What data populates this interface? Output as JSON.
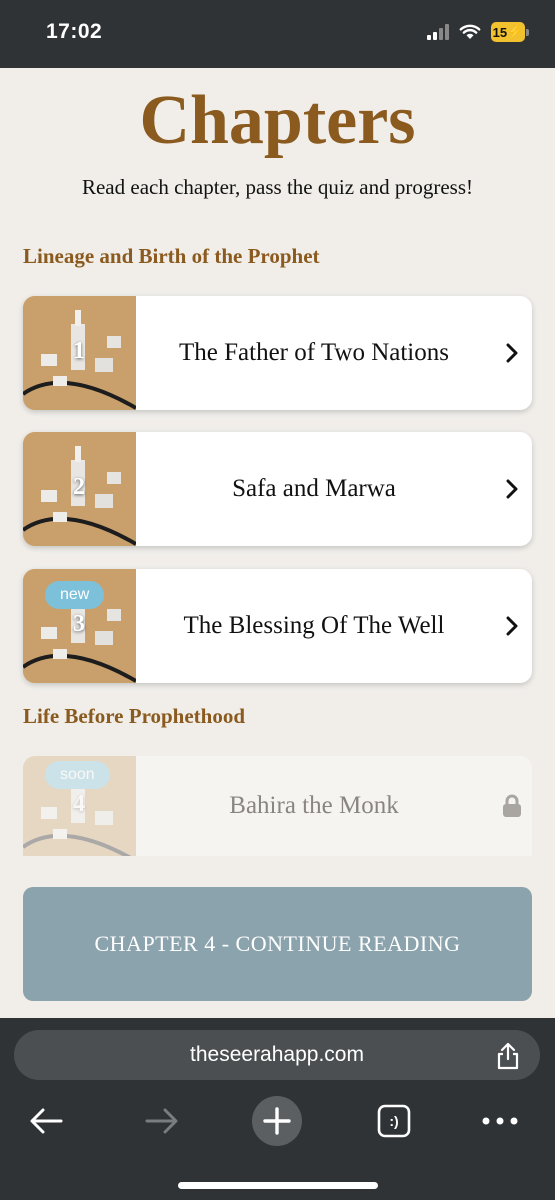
{
  "status_bar": {
    "time": "17:02",
    "battery": "15"
  },
  "page": {
    "title": "Chapters",
    "subtitle": "Read each chapter, pass the quiz and progress!"
  },
  "sections": [
    {
      "heading": "Lineage and Birth of the Prophet"
    },
    {
      "heading": "Life Before Prophethood"
    }
  ],
  "chapters": [
    {
      "number": "1",
      "title": "The Father of Two Nations",
      "badge": "",
      "locked": false
    },
    {
      "number": "2",
      "title": "Safa and Marwa",
      "badge": "",
      "locked": false
    },
    {
      "number": "3",
      "title": "The Blessing Of The Well",
      "badge": "new",
      "locked": false
    },
    {
      "number": "4",
      "title": "Bahira the Monk",
      "badge": "soon",
      "locked": true
    }
  ],
  "continue_button": {
    "label": "CHAPTER 4 - CONTINUE READING"
  },
  "browser": {
    "url": "theseerahapp.com",
    "tabs_icon_label": ":)"
  },
  "colors": {
    "accent": "#8a5a1e",
    "badge": "#7cc0da",
    "button": "#8ba3ac",
    "chrome": "#2f3336"
  }
}
